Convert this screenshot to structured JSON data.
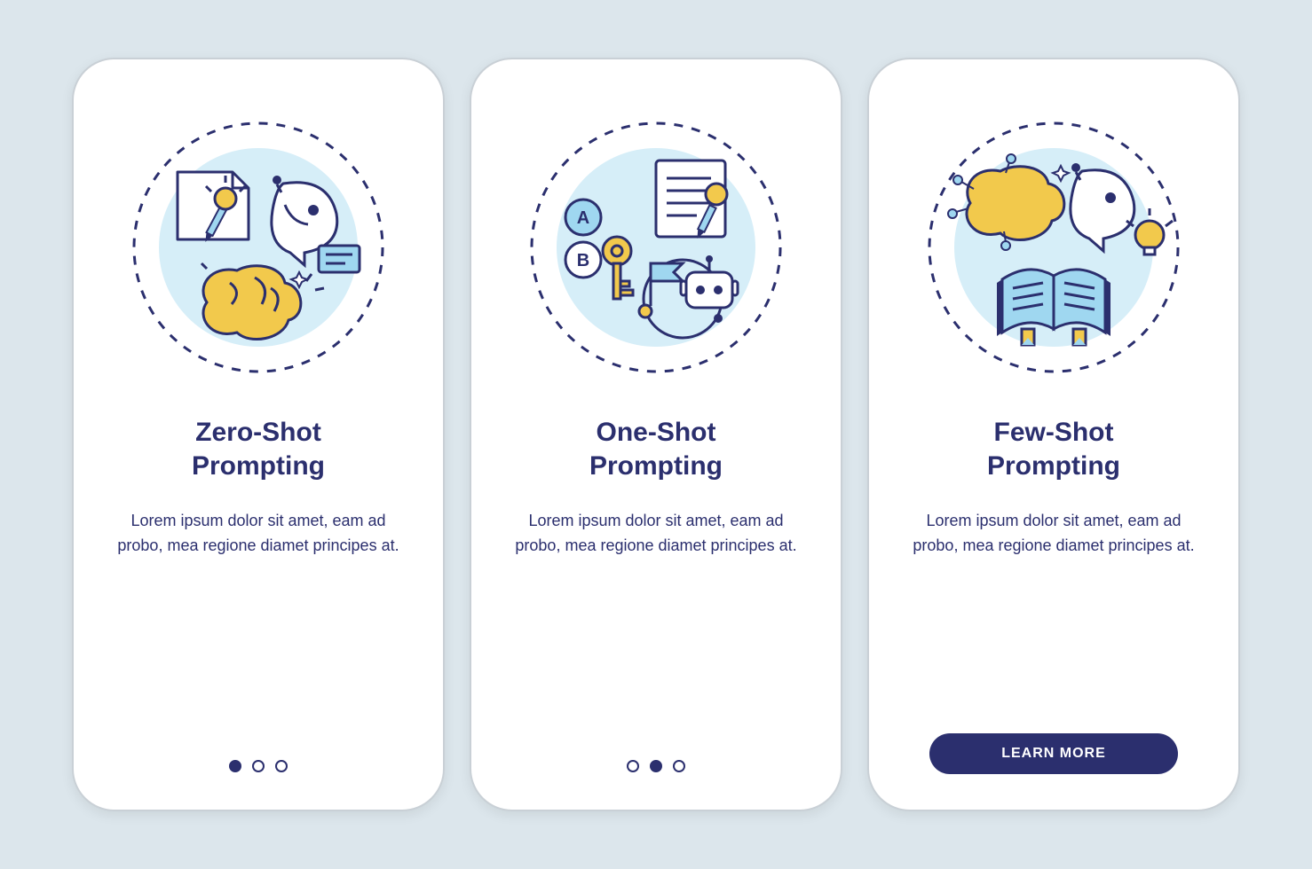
{
  "colors": {
    "navy": "#2b2f6e",
    "accentYellow": "#f2c94c",
    "accentBlue": "#9fd7f0",
    "bgPage": "#dce6ec"
  },
  "screens": [
    {
      "title": "Zero-Shot\nPrompting",
      "description": "Lorem ipsum dolor sit amet, eam ad probo, mea regione diamet principes at.",
      "pagination": {
        "active": 0,
        "count": 3
      },
      "illustration": "zero-shot"
    },
    {
      "title": "One-Shot\nPrompting",
      "description": "Lorem ipsum dolor sit amet, eam ad probo, mea regione diamet principes at.",
      "pagination": {
        "active": 1,
        "count": 3
      },
      "illustration": "one-shot"
    },
    {
      "title": "Few-Shot\nPrompting",
      "description": "Lorem ipsum dolor sit amet, eam ad probo, mea regione diamet principes at.",
      "cta": "LEARN MORE",
      "illustration": "few-shot"
    }
  ]
}
